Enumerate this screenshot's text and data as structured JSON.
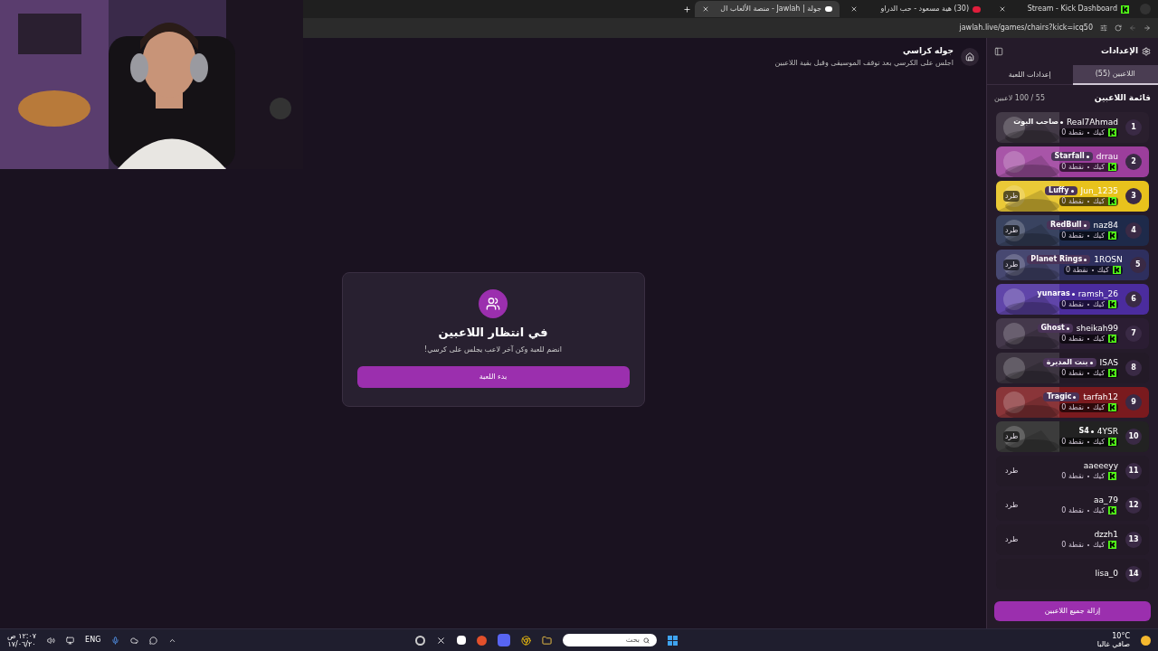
{
  "browser": {
    "tabs": [
      {
        "title": "Stream - Kick Dashboard",
        "selected": false
      },
      {
        "title": "(30) هية مسعود - حب الدراو",
        "selected": false
      },
      {
        "title": "جولة | Jawlah - منصة الألعاب ال",
        "selected": true
      }
    ],
    "url": "jawlah.live/games/chairs?kick=icq50"
  },
  "header": {
    "title": "جوله كراسي",
    "subtitle": "اجلس على الكرسي بعد توقف الموسيقى وقبل بقية اللاعبين"
  },
  "waiting_card": {
    "title": "في انتظار اللاعبين",
    "message": "انضم للعبة وكن آخر لاعب يجلس على كرسي!",
    "button": "بدء اللعبة"
  },
  "sidebar": {
    "title": "الإعدادات",
    "tabs": [
      {
        "label": "اللاعبين (55)",
        "selected": true
      },
      {
        "label": "إعدادات اللعبة",
        "selected": false
      }
    ],
    "list_title": "قائمة اللاعبين",
    "count": "55 / 100 لاعبين",
    "players": [
      {
        "rank": "1",
        "name": "Real7Ahmad",
        "badge": {
          "text": "صاحب البوت",
          "kind": "plain"
        },
        "platform": "كيك",
        "points": "0 نقطة",
        "kind": "banner",
        "color": "#2a1f2e"
      },
      {
        "rank": "2",
        "name": "drrau",
        "badge": {
          "text": "Starfall",
          "kind": "pill"
        },
        "platform": "كيك",
        "points": "0 نقطة",
        "kind": "banner",
        "color": "#9c3e9c"
      },
      {
        "rank": "3",
        "name": "Jun_1235",
        "badge": {
          "text": "Luffy",
          "kind": "pill"
        },
        "platform": "كيك",
        "points": "0 نقطة",
        "kick": "طرد",
        "kind": "banner",
        "color": "#e8c21c"
      },
      {
        "rank": "4",
        "name": "naz84",
        "badge": {
          "text": "RedBull",
          "kind": "pill"
        },
        "platform": "كيك",
        "points": "0 نقطة",
        "kick": "طرد",
        "kind": "banner",
        "color": "#1e2a4a"
      },
      {
        "rank": "5",
        "name": "1ROSN",
        "badge": {
          "text": "Planet Rings",
          "kind": "pill"
        },
        "platform": "كيك",
        "points": "0 نقطة",
        "kick": "طرد",
        "kind": "banner",
        "color": "#2e2f5e"
      },
      {
        "rank": "6",
        "name": "ramsh_26",
        "badge": {
          "text": "yunaras",
          "kind": "plain"
        },
        "platform": "كيك",
        "points": "0 نقطة",
        "kind": "banner",
        "color": "#4b2c9e"
      },
      {
        "rank": "7",
        "name": "sheikah99",
        "badge": {
          "text": "Ghost",
          "kind": "pill"
        },
        "platform": "كيك",
        "points": "0 نقطة",
        "kind": "banner",
        "color": "#2b1d33"
      },
      {
        "rank": "8",
        "name": "ISAS",
        "badge": {
          "text": "بنت المديرة",
          "kind": "pill"
        },
        "platform": "كيك",
        "points": "0 نقطة",
        "kind": "banner",
        "color": "#231a27"
      },
      {
        "rank": "9",
        "name": "tarfah12",
        "badge": {
          "text": "Tragic",
          "kind": "pill"
        },
        "platform": "كيك",
        "points": "0 نقطة",
        "kind": "banner",
        "color": "#7a1a1e"
      },
      {
        "rank": "10",
        "name": "4YSR",
        "badge": {
          "text": "S4",
          "kind": "plain"
        },
        "platform": "كيك",
        "points": "0 نقطة",
        "kick": "طرد",
        "kind": "banner",
        "color": "#222222"
      },
      {
        "rank": "11",
        "name": "aaeeeyy",
        "platform": "كيك",
        "points": "0 نقطة",
        "kick": "طرد",
        "kind": "plain"
      },
      {
        "rank": "12",
        "name": "aa_79",
        "platform": "كيك",
        "points": "0 نقطة",
        "kick": "طرد",
        "kind": "plain"
      },
      {
        "rank": "13",
        "name": "dzzh1",
        "platform": "كيك",
        "points": "0 نقطة",
        "kick": "طرد",
        "kind": "plain"
      },
      {
        "rank": "14",
        "name": "lisa_0",
        "kind": "plain"
      }
    ],
    "remove_all": "إزالة جميع اللاعبين"
  },
  "taskbar": {
    "time": "١٢:٠٧ ص",
    "date": "١٧/٠٦/٢٠",
    "language": "ENG",
    "search_placeholder": "بحث",
    "temperature": "10°C",
    "weather": "صافي غالبا"
  }
}
